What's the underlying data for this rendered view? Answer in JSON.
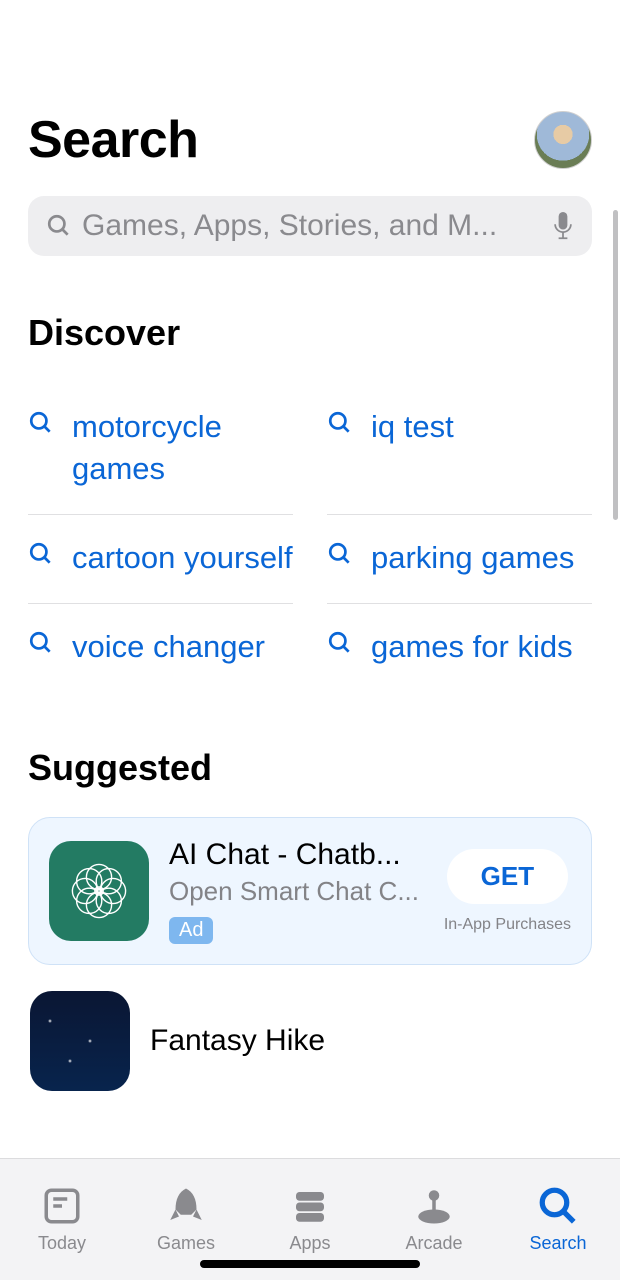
{
  "header": {
    "title": "Search"
  },
  "search": {
    "placeholder": "Games, Apps, Stories, and M..."
  },
  "discover": {
    "title": "Discover",
    "items": [
      "motorcycle games",
      "iq test",
      "cartoon yourself",
      "parking games",
      "voice changer",
      "games for kids"
    ]
  },
  "suggested": {
    "title": "Suggested",
    "ad": {
      "name": "AI Chat - Chatb...",
      "subtitle": "Open Smart Chat C...",
      "badge": "Ad",
      "action": "GET",
      "iap": "In-App Purchases"
    },
    "next": {
      "name": "Fantasy Hike"
    }
  },
  "tabs": {
    "today": "Today",
    "games": "Games",
    "apps": "Apps",
    "arcade": "Arcade",
    "search": "Search"
  },
  "colors": {
    "link": "#0a66d6",
    "card_bg": "#eef6ff"
  }
}
